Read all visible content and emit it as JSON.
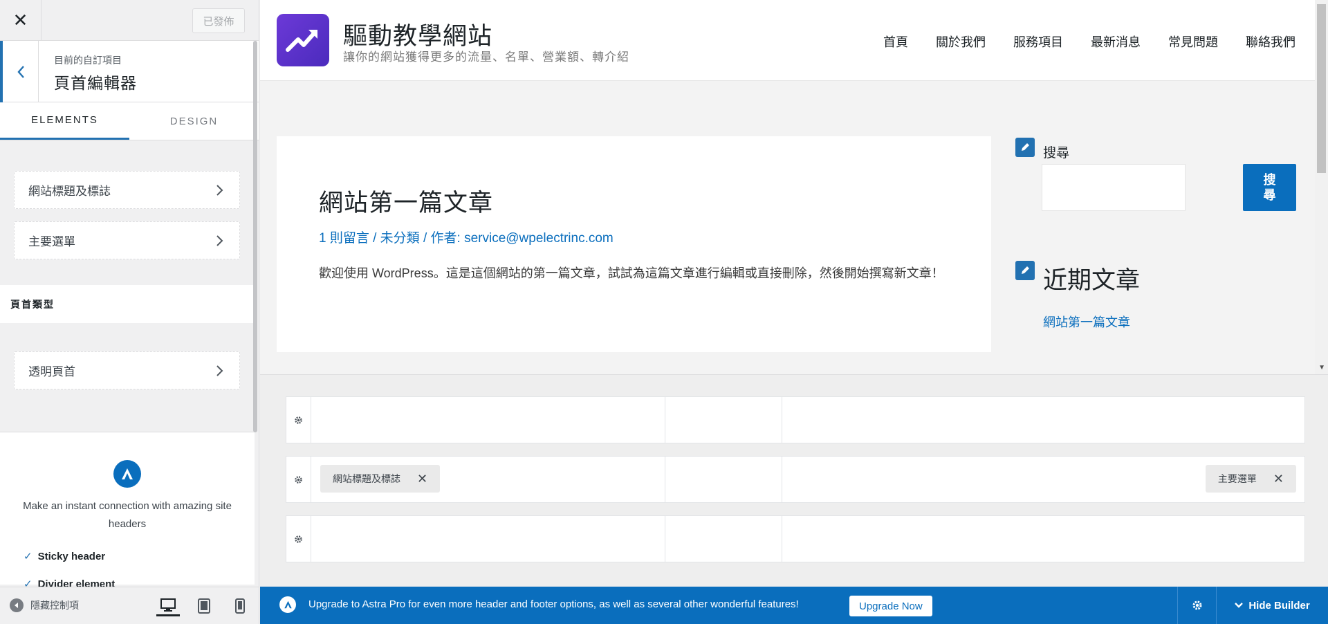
{
  "panel": {
    "publish_label": "已發佈",
    "section_subtitle": "目前的自訂項目",
    "section_title": "頁首編輯器",
    "tabs": [
      {
        "label": "ELEMENTS",
        "active": true
      },
      {
        "label": "DESIGN",
        "active": false
      }
    ],
    "controls": [
      {
        "label": "網站標題及標誌"
      },
      {
        "label": "主要選單"
      }
    ],
    "header_type_heading": "頁首類型",
    "transparent_header_label": "透明頁首",
    "promo": {
      "text": "Make an instant connection with amazing site headers",
      "features": [
        "Sticky header",
        "Divider element"
      ]
    },
    "collapse_label": "隱藏控制項",
    "devices": [
      "desktop-icon",
      "tablet-icon",
      "mobile-icon"
    ]
  },
  "site": {
    "title": "驅動教學網站",
    "tagline": "讓你的網站獲得更多的流量、名單、營業額、轉介紹",
    "nav": [
      "首頁",
      "關於我們",
      "服務項目",
      "最新消息",
      "常見問題",
      "聯絡我們"
    ]
  },
  "post": {
    "title": "網站第一篇文章",
    "meta": "1 則留言 / 未分類 / 作者: service@wpelectrinc.com",
    "body": "歡迎使用 WordPress。這是這個網站的第一篇文章，試試為這篇文章進行編輯或直接刪除，然後開始撰寫新文章！"
  },
  "sidebar": {
    "search_label": "搜尋",
    "search_button": "搜尋",
    "recent_title": "近期文章",
    "recent_link": "網站第一篇文章"
  },
  "builder": {
    "rows": [
      {
        "chips": []
      },
      {
        "chips": [
          {
            "label": "網站標題及標誌"
          },
          {
            "label": "主要選單"
          }
        ]
      },
      {
        "chips": []
      }
    ]
  },
  "upgrade_bar": {
    "text": "Upgrade to Astra Pro for even more header and footer options, as well as several other wonderful features!",
    "button_label": "Upgrade Now",
    "hide_label": "Hide Builder"
  },
  "colors": {
    "accent": "#2271b1",
    "astra_blue": "#0a6ebd",
    "logo_purple": "#5b33cc"
  }
}
